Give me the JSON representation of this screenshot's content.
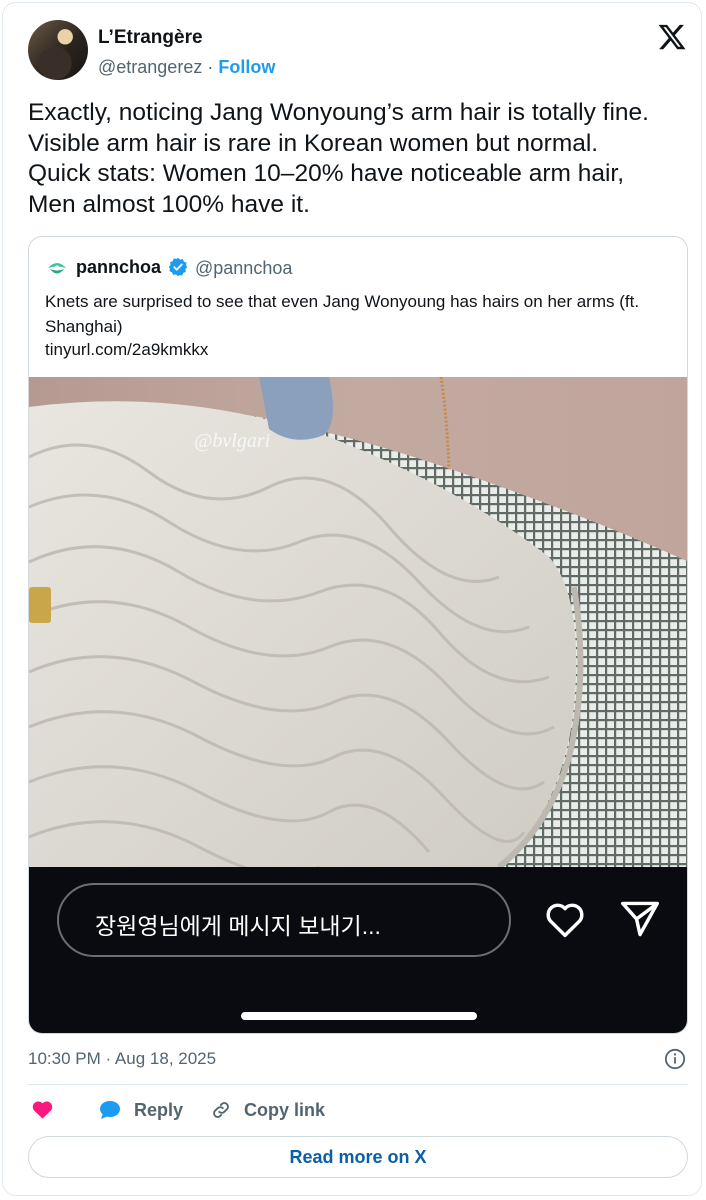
{
  "author": {
    "display_name": "L’Etrangère",
    "handle": "@etrangerez",
    "separator": "·",
    "follow_label": "Follow"
  },
  "tweet": {
    "text": "Exactly, noticing Jang Wonyoung’s arm hair is totally fine.\nVisible arm hair is rare in Korean women but normal.\nQuick stats: Women 10–20% have noticeable arm hair,\nMen almost 100% have it.",
    "timestamp": "10:30 PM · Aug 18, 2025"
  },
  "quoted": {
    "display_name": "pannchoa",
    "handle": "@pannchoa",
    "text": "Knets are surprised to see that even Jang Wonyoung has hairs on her arms (ft. Shanghai)",
    "link": "tinyurl.com/2a9kmkkx",
    "photo_watermark": "@bvlgari",
    "message_placeholder": "장원영님에게 메시지 보내기..."
  },
  "actions": {
    "reply_label": "Reply",
    "copy_link_label": "Copy link",
    "read_more_label": "Read more on X"
  },
  "colors": {
    "accent": "#1d9bf0",
    "like": "#f91880",
    "reply_icon": "#1d9bf0",
    "read_more": "#0a5fa6"
  },
  "icons": [
    "x-logo-icon",
    "verified-badge-icon",
    "heart-icon",
    "send-icon",
    "info-icon",
    "like-heart-icon",
    "reply-bubble-icon",
    "link-icon"
  ]
}
